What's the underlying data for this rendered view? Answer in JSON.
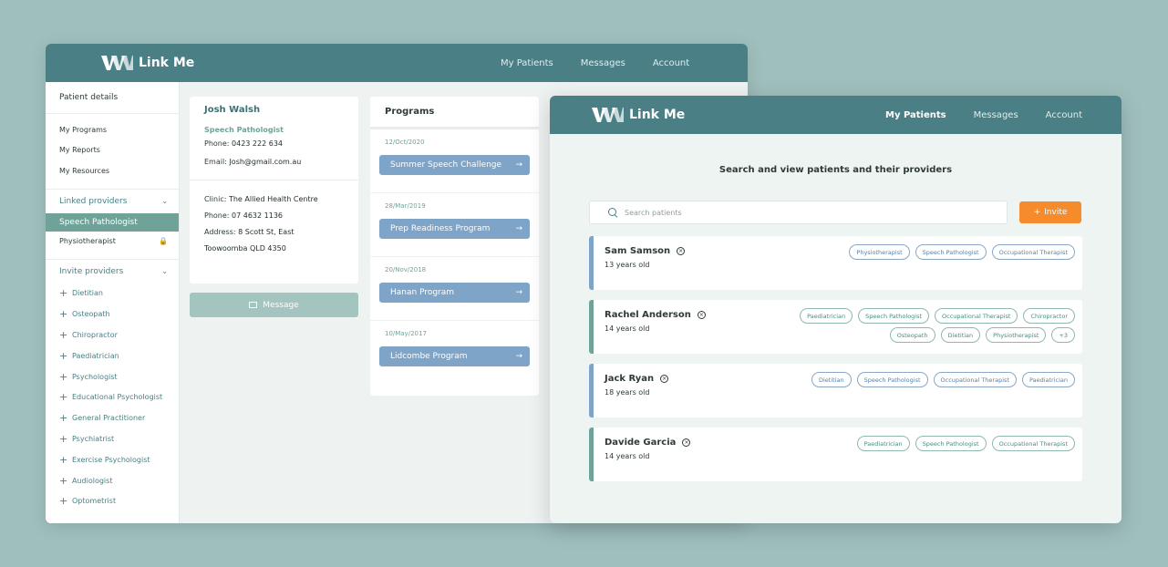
{
  "brand": {
    "name": "Link Me"
  },
  "colors": {
    "topbar": "#4a7f85",
    "accent_green": "#6fa39a",
    "accent_blue": "#7ea4c7",
    "invite_orange": "#f58b2a"
  },
  "back_nav": [
    "My Patients",
    "Messages",
    "Account"
  ],
  "sidebar": {
    "header": "Patient details",
    "items": [
      "My Programs",
      "My Reports",
      "My Resources"
    ],
    "linked_title": "Linked providers",
    "linked": [
      {
        "label": "Speech Pathologist",
        "selected": true
      },
      {
        "label": "Physiotherapist",
        "locked": true
      }
    ],
    "invite_title": "Invite providers",
    "invite": [
      "Dietitian",
      "Osteopath",
      "Chiropractor",
      "Paediatrician",
      "Psychologist",
      "Educational Psychologist",
      "General Practitioner",
      "Psychiatrist",
      "Exercise Psychologist",
      "Audiologist",
      "Optometrist"
    ]
  },
  "contact": {
    "name": "Josh Walsh",
    "role": "Speech Pathologist",
    "phone_label": "Phone:",
    "phone": "0423 222 634",
    "email_label": "Email:",
    "email": "Josh@gmail.com.au",
    "clinic_label": "Clinic:",
    "clinic": "The Allied Health Centre",
    "clinic_phone_label": "Phone:",
    "clinic_phone": "07 4632 1136",
    "address_label": "Address:",
    "address_line1": "8 Scott St, East",
    "address_line2": "Toowoomba QLD 4350",
    "message_button": "Message"
  },
  "programs": {
    "title": "Programs",
    "items": [
      {
        "date": "12/Oct/2020",
        "name": "Summer Speech Challenge"
      },
      {
        "date": "28/Mar/2019",
        "name": "Prep Readiness Program"
      },
      {
        "date": "20/Nov/2018",
        "name": "Hanan Program"
      },
      {
        "date": "10/May/2017",
        "name": "Lidcombe Program"
      }
    ]
  },
  "front_nav": [
    "My Patients",
    "Messages",
    "Account"
  ],
  "front": {
    "heading": "Search and view patients and their providers",
    "search_placeholder": "Search patients",
    "invite_label": "Invite",
    "invite_plus": "+"
  },
  "patients": [
    {
      "name": "Sam Samson",
      "age": "13 years old",
      "bar": "#7ea4c7",
      "tag_style": "blue",
      "tags": [
        "Physiotherapist",
        "Speech Pathologist",
        "Occupational Therapist"
      ]
    },
    {
      "name": "Rachel Anderson",
      "age": "14 years old",
      "bar": "#6fa39a",
      "tag_style": "green",
      "tags": [
        "Paediatrician",
        "Speech Pathologist",
        "Occupational Therapist",
        "Chiropractor",
        "Osteopath",
        "Dietitian",
        "Physiotherapist",
        "+3"
      ]
    },
    {
      "name": "Jack Ryan",
      "age": "18 years old",
      "bar": "#7ea4c7",
      "tag_style": "blue",
      "tags": [
        "Dietitian",
        "Speech Pathologist",
        "Occupational Therapist",
        "Paediatrician"
      ]
    },
    {
      "name": "Davide Garcia",
      "age": "14 years old",
      "bar": "#6fa39a",
      "tag_style": "green",
      "tags": [
        "Paediatrician",
        "Speech Pathologist",
        "Occupational Therapist"
      ]
    }
  ]
}
